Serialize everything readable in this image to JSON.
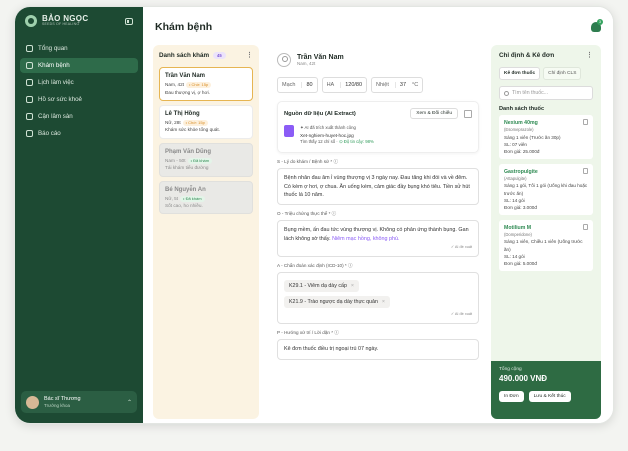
{
  "brand": {
    "name": "BẢO NGỌC",
    "sub": "SEEDS OF HEALING"
  },
  "nav": [
    {
      "label": "Tổng quan",
      "active": false
    },
    {
      "label": "Khám bệnh",
      "active": true
    },
    {
      "label": "Lịch làm việc",
      "active": false
    },
    {
      "label": "Hồ sơ sức khoẻ",
      "active": false
    },
    {
      "label": "Cận lâm sàn",
      "active": false
    },
    {
      "label": "Báo cáo",
      "active": false
    }
  ],
  "user": {
    "name": "Bác sĩ Thương",
    "role": "Trưởng khoa"
  },
  "page": {
    "title": "Khám bệnh"
  },
  "notification_count": "3",
  "queue": {
    "title": "Danh sách khám",
    "count": "45",
    "patients": [
      {
        "name": "Trần Văn Nam",
        "meta": "Nam, 42t",
        "status": "Chờ: 15p",
        "note": "Đau thượng vị, ợ hơi."
      },
      {
        "name": "Lê Thị Hồng",
        "meta": "Nữ, 28t",
        "status": "Chờ: 15p",
        "note": "Khám sức khỏe tổng quát."
      },
      {
        "name": "Phạm Văn Dũng",
        "meta": "Nam - 50t",
        "status": "Đã khám",
        "note": "Tái khám tiểu đường"
      },
      {
        "name": "Bé Nguyễn An",
        "meta": "Nữ, 5t",
        "status": "Đã khám",
        "note": "Sốt cao, ho nhiều."
      }
    ]
  },
  "patient": {
    "name": "Trần Văn Nam",
    "meta": "Nam, 42t",
    "vitals": {
      "pulse_label": "Mạch",
      "pulse": "80",
      "bp_label": "HA",
      "bp": "120/80",
      "temp_label": "Nhiệt",
      "temp": "37",
      "temp_unit": "°C"
    }
  },
  "source": {
    "title": "Nguồn dữ liệu (AI Extract)",
    "button": "Xem & Đối chiếu",
    "ai_line": "✦ AI đã trích xuất thành công",
    "file": "Xet-nghiem-huyet-hoc.jpg",
    "found": "Tìm thấy 12 chỉ số",
    "confidence": "⊙ Độ tin cậy: 98%"
  },
  "soap": {
    "s_label": "S - Lý do khám / Bệnh sử * ⓘ",
    "s_text": "Bệnh nhân đau âm ỉ vùng thượng vị 3 ngày nay. Đau tăng khi đói và về đêm. Có kèm ợ hơi, ợ chua. Ăn uống kém, cảm giác đầy bụng khó tiêu. Tiền sử hút thuốc lá 10 năm.",
    "o_label": "O - Triệu chứng thực thể * ⓘ",
    "o_text_a": "Bụng mềm, ấn đau tức vùng thượng vị. Không có phản ứng thành bụng. Gan lách không sờ thấy. ",
    "o_text_b": "Niêm mạc hồng, không phù.",
    "ai_suggest": "✓ AI đề xuất",
    "a_label": "A - Chẩn đoán xác định (ICD-10) * ⓘ",
    "diagnoses": [
      "K29.1 - Viêm dạ dày cấp",
      "K21.9 - Trào ngược dạ dày thực quản"
    ],
    "p_label": "P - Hướng xử trí / Lời dặn * ⓘ",
    "p_text": "Kê đơn thuốc điều trị ngoại trú 07 ngày."
  },
  "orders": {
    "title": "Chỉ định & Kê đơn",
    "tab_rx": "Kê đơn thuốc",
    "tab_cls": "Chỉ định CLS",
    "search_placeholder": "Tìm tên thuốc...",
    "list_title": "Danh sách thuốc",
    "drugs": [
      {
        "name": "Nexium 40mg",
        "generic": "(Esomeprazole)",
        "dose": "Sáng 1 viên (Trước ăn 30p)",
        "qty": "SL: 07 viên",
        "price": "Đơn giá: 25.000đ"
      },
      {
        "name": "Gastropulgite",
        "generic": "(Attapulgite)",
        "dose": "Sáng 1 gói, Tối 1 gói (Uống khi đau hoặc trước ăn)",
        "qty": "SL: 14 gói",
        "price": "Đơn giá: 3.000đ"
      },
      {
        "name": "Motilium M",
        "generic": "(Domperidone)",
        "dose": "Sáng 1 viên, Chiều 1 viên (Uống trước ăn)",
        "qty": "SL: 14 gói",
        "price": "Đơn giá: 5.000đ"
      }
    ],
    "total_label": "Tổng cộng",
    "total": "490.000 VNĐ",
    "print_btn": "In Đơn",
    "save_btn": "Lưu & Kết thúc"
  }
}
